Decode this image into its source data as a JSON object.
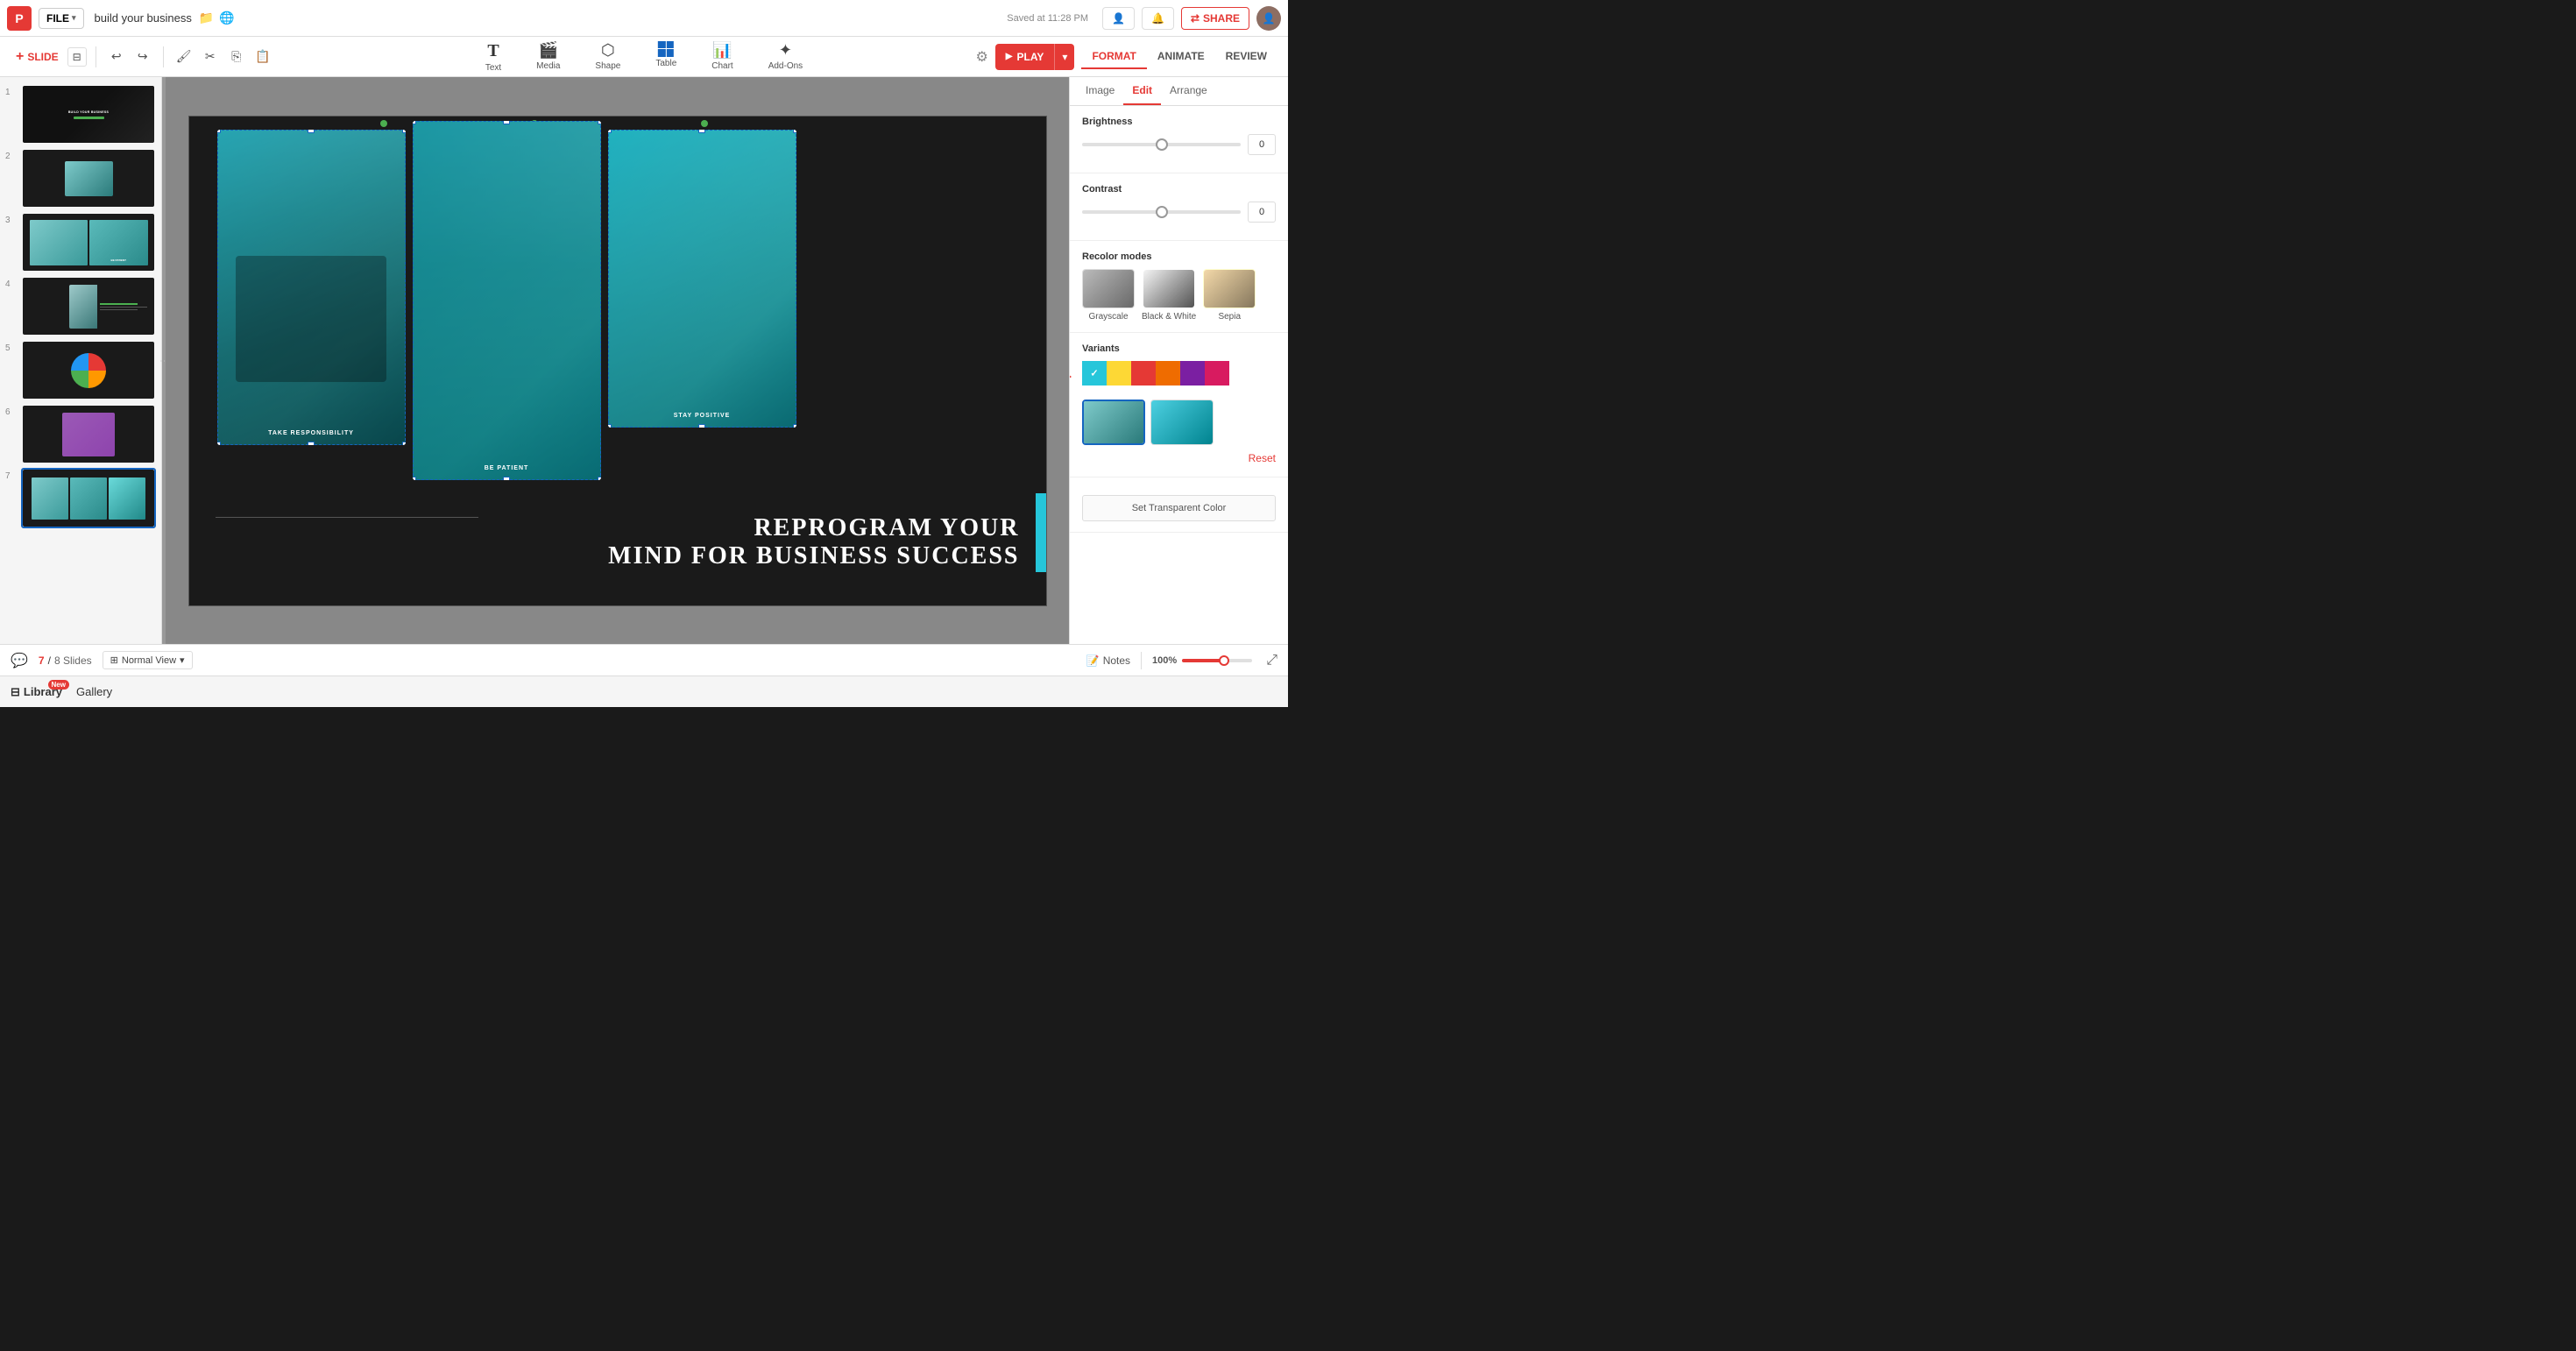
{
  "app": {
    "logo": "P",
    "file_label": "FILE",
    "project_title": "build your business",
    "saved_text": "Saved at 11:28 PM",
    "share_label": "SHARE"
  },
  "toolbar": {
    "slide_label": "SLIDE",
    "tools": [
      {
        "name": "Text",
        "icon": "T"
      },
      {
        "name": "Media",
        "icon": "🎬"
      },
      {
        "name": "Shape",
        "icon": "◇"
      },
      {
        "name": "Table",
        "icon": "⊞"
      },
      {
        "name": "Chart",
        "icon": "📊"
      },
      {
        "name": "Add-Ons",
        "icon": "✦"
      }
    ],
    "play_label": "PLAY"
  },
  "format_tabs": [
    {
      "label": "FORMAT",
      "active": true
    },
    {
      "label": "ANIMATE",
      "active": false
    },
    {
      "label": "REVIEW",
      "active": false
    }
  ],
  "edit_tabs": [
    {
      "label": "Image",
      "active": false
    },
    {
      "label": "Edit",
      "active": true
    },
    {
      "label": "Arrange",
      "active": false
    }
  ],
  "right_panel": {
    "brightness_label": "Brightness",
    "brightness_value": "0",
    "contrast_label": "Contrast",
    "contrast_value": "0",
    "recolor_label": "Recolor modes",
    "recolor_modes": [
      {
        "label": "Grayscale"
      },
      {
        "label": "Black & White"
      },
      {
        "label": "Sepia"
      }
    ],
    "variants_label": "Variants",
    "variant_colors": [
      "#26c6da",
      "#fdd835",
      "#e53935",
      "#ef6c00",
      "#7b1fa2",
      "#d81b60"
    ],
    "reset_label": "Reset",
    "transparent_label": "Set Transparent Color"
  },
  "slide": {
    "images": [
      {
        "caption": "TAKE RESPONSIBILITY"
      },
      {
        "caption": "BE PATIENT"
      },
      {
        "caption": "STAY POSITIVE"
      }
    ],
    "bottom_line1": "REPROGRAM YOUR",
    "bottom_line2": "MIND FOR BUSINESS SUCCESS"
  },
  "status": {
    "current_slide": "7",
    "total_slides": "8 Slides",
    "view_label": "Normal View",
    "notes_label": "Notes",
    "zoom_value": "100%"
  },
  "bottom_bar": {
    "library_label": "Library",
    "new_badge": "New",
    "gallery_label": "Gallery"
  },
  "slides_panel": [
    {
      "num": 1
    },
    {
      "num": 2
    },
    {
      "num": 3
    },
    {
      "num": 4
    },
    {
      "num": 5
    },
    {
      "num": 6
    },
    {
      "num": 7
    }
  ]
}
